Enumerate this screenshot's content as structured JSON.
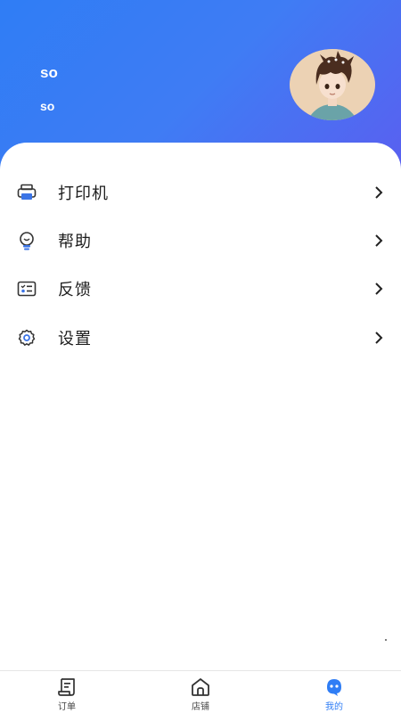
{
  "profile": {
    "name": "so",
    "id": "so"
  },
  "menu": [
    {
      "label": "打印机",
      "icon": "printer-icon"
    },
    {
      "label": "帮助",
      "icon": "lightbulb-icon"
    },
    {
      "label": "反馈",
      "icon": "feedback-card-icon"
    },
    {
      "label": "设置",
      "icon": "gear-icon"
    }
  ],
  "tabs": [
    {
      "label": "订单",
      "icon": "order-scroll-icon",
      "active": false
    },
    {
      "label": "店铺",
      "icon": "store-home-icon",
      "active": false
    },
    {
      "label": "我的",
      "icon": "profile-face-icon",
      "active": true
    }
  ],
  "colors": {
    "header_gradient_start": "#2f7df5",
    "header_gradient_end": "#5a5ff0",
    "accent": "#2f7df5",
    "text": "#1e1e1e"
  }
}
